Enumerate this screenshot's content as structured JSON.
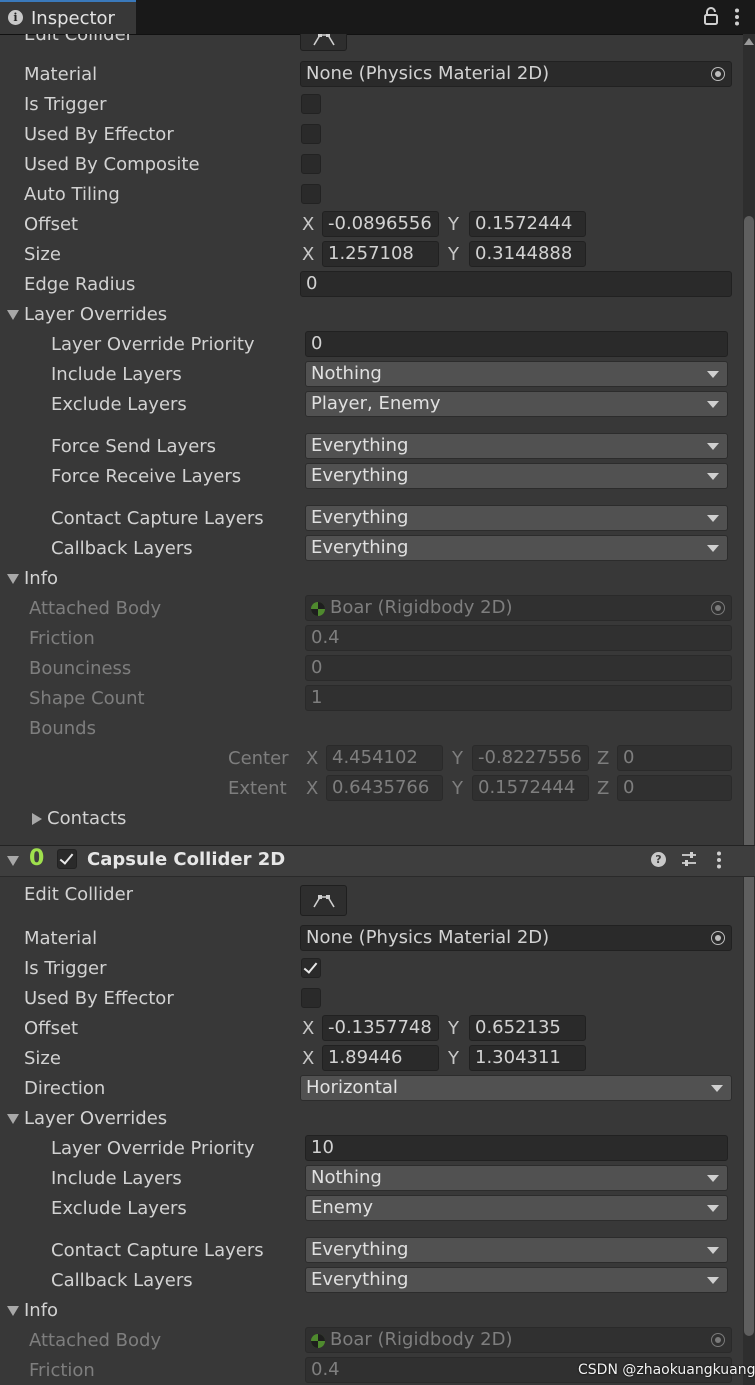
{
  "window": {
    "tab_title": "Inspector"
  },
  "box_collider": {
    "edit_collider_label": "Edit Collider",
    "material": {
      "label": "Material",
      "value": "None (Physics Material 2D)"
    },
    "is_trigger": {
      "label": "Is Trigger",
      "checked": false
    },
    "used_by_effector": {
      "label": "Used By Effector",
      "checked": false
    },
    "used_by_composite": {
      "label": "Used By Composite",
      "checked": false
    },
    "auto_tiling": {
      "label": "Auto Tiling",
      "checked": false
    },
    "offset": {
      "label": "Offset",
      "x": "-0.0896556",
      "y": "0.1572444"
    },
    "size": {
      "label": "Size",
      "x": "1.257108",
      "y": "0.3144888"
    },
    "edge_radius": {
      "label": "Edge Radius",
      "value": "0"
    },
    "layer_overrides": {
      "label": "Layer Overrides",
      "priority": {
        "label": "Layer Override Priority",
        "value": "0"
      },
      "include": {
        "label": "Include Layers",
        "value": "Nothing"
      },
      "exclude": {
        "label": "Exclude Layers",
        "value": "Player, Enemy"
      },
      "force_send": {
        "label": "Force Send Layers",
        "value": "Everything"
      },
      "force_receive": {
        "label": "Force Receive Layers",
        "value": "Everything"
      },
      "contact_capture": {
        "label": "Contact Capture Layers",
        "value": "Everything"
      },
      "callback": {
        "label": "Callback Layers",
        "value": "Everything"
      }
    },
    "info": {
      "label": "Info",
      "attached_body": {
        "label": "Attached Body",
        "value": "Boar (Rigidbody 2D)"
      },
      "friction": {
        "label": "Friction",
        "value": "0.4"
      },
      "bounciness": {
        "label": "Bounciness",
        "value": "0"
      },
      "shape_count": {
        "label": "Shape Count",
        "value": "1"
      },
      "bounds": {
        "label": "Bounds",
        "center": {
          "label": "Center",
          "x": "4.454102",
          "y": "-0.8227556",
          "z": "0"
        },
        "extent": {
          "label": "Extent",
          "x": "0.6435766",
          "y": "0.1572444",
          "z": "0"
        }
      },
      "contacts_label": "Contacts"
    }
  },
  "axis": {
    "x": "X",
    "y": "Y",
    "z": "Z"
  },
  "capsule_collider": {
    "title": "Capsule Collider 2D",
    "enabled": true,
    "icon_glyph": "0",
    "edit_collider_label": "Edit Collider",
    "material": {
      "label": "Material",
      "value": "None (Physics Material 2D)"
    },
    "is_trigger": {
      "label": "Is Trigger",
      "checked": true
    },
    "used_by_effector": {
      "label": "Used By Effector",
      "checked": false
    },
    "offset": {
      "label": "Offset",
      "x": "-0.1357748",
      "y": "0.652135"
    },
    "size": {
      "label": "Size",
      "x": "1.89446",
      "y": "1.304311"
    },
    "direction": {
      "label": "Direction",
      "value": "Horizontal"
    },
    "layer_overrides": {
      "label": "Layer Overrides",
      "priority": {
        "label": "Layer Override Priority",
        "value": "10"
      },
      "include": {
        "label": "Include Layers",
        "value": "Nothing"
      },
      "exclude": {
        "label": "Exclude Layers",
        "value": "Enemy"
      },
      "contact_capture": {
        "label": "Contact Capture Layers",
        "value": "Everything"
      },
      "callback": {
        "label": "Callback Layers",
        "value": "Everything"
      }
    },
    "info": {
      "label": "Info",
      "attached_body": {
        "label": "Attached Body",
        "value": "Boar (Rigidbody 2D)"
      },
      "friction": {
        "label": "Friction",
        "value": "0.4"
      }
    }
  },
  "icons": {
    "lock": "lock-icon",
    "menu": "kebab-menu-icon",
    "info": "info-icon",
    "help": "help-icon",
    "presets": "presets-icon",
    "object_picker": "object-picker-icon",
    "edit_collider": "edit-collider-icon",
    "rigidbody": "rigidbody-icon",
    "capsule": "capsule-collider-icon"
  },
  "colors": {
    "background": "#383838",
    "field": "#2a2a2a",
    "dropdown": "#515151",
    "text": "#d2d2d2",
    "disabled_text": "#7e7e7e",
    "capsule_icon": "#9fe04d",
    "tab_accent": "#3a79bb"
  },
  "watermark": "CSDN @zhaokuangkuang_"
}
